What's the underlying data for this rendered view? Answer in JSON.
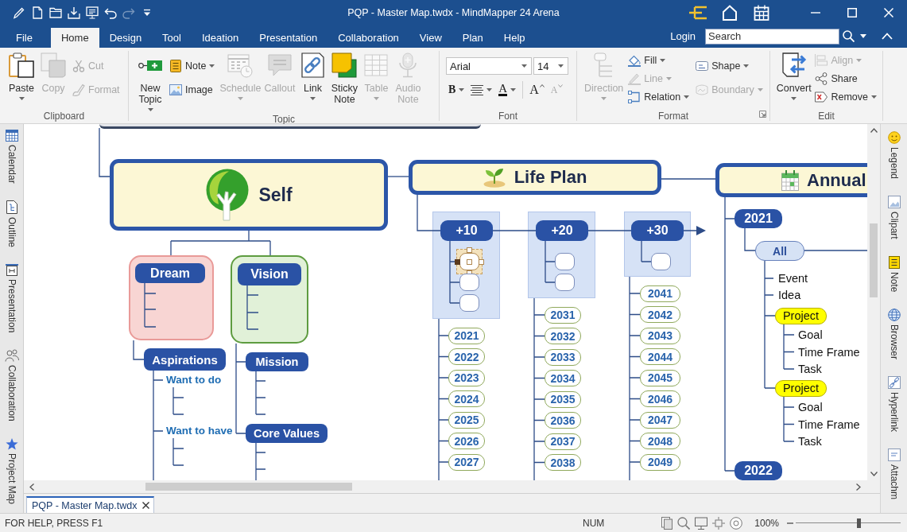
{
  "window": {
    "title": "PQP - Master Map.twdx - MindMapper 24 Arena"
  },
  "quick_access": [
    {
      "disabled": false
    },
    {
      "disabled": false
    },
    {
      "disabled": false
    },
    {
      "disabled": false
    },
    {
      "disabled": false
    },
    {
      "disabled": false
    },
    {
      "disabled": true
    },
    {
      "disabled": false
    }
  ],
  "menu": {
    "tabs": [
      {
        "label": "File",
        "selected": false
      },
      {
        "label": "Home",
        "selected": true
      },
      {
        "label": "Design",
        "selected": false
      },
      {
        "label": "Tool",
        "selected": false
      },
      {
        "label": "Ideation",
        "selected": false
      },
      {
        "label": "Presentation",
        "selected": false
      },
      {
        "label": "Collaboration",
        "selected": false
      },
      {
        "label": "View",
        "selected": false
      },
      {
        "label": "Plan",
        "selected": false
      },
      {
        "label": "Help",
        "selected": false
      }
    ],
    "login": "Login",
    "search": {
      "placeholder": "Search"
    }
  },
  "ribbon": {
    "groups": [
      {
        "label": "Clipboard",
        "launcher": false,
        "items": [
          {
            "kind": "large",
            "label": "Paste",
            "dropdown": true,
            "disabled": false
          },
          {
            "kind": "large",
            "label": "Copy",
            "dropdown": false,
            "disabled": true
          },
          {
            "kind": "stack",
            "items": [
              {
                "label": "Cut",
                "dropdown": false,
                "disabled": true
              },
              {
                "label": "Format",
                "dropdown": false,
                "disabled": true
              }
            ]
          }
        ]
      },
      {
        "label": "Topic",
        "launcher": false,
        "items": [
          {
            "kind": "large",
            "label": "New Topic",
            "dropdown": true,
            "disabled": false
          },
          {
            "kind": "stack",
            "items": [
              {
                "label": "Note",
                "dropdown": true,
                "disabled": false
              },
              {
                "label": "Image",
                "dropdown": false,
                "disabled": false
              }
            ]
          },
          {
            "kind": "large",
            "label": "Schedule",
            "dropdown": true,
            "disabled": true
          },
          {
            "kind": "large",
            "label": "Callout",
            "dropdown": false,
            "disabled": true
          },
          {
            "kind": "large",
            "label": "Link",
            "dropdown": true,
            "disabled": false
          },
          {
            "kind": "large",
            "label": "Sticky Note",
            "dropdown": false,
            "disabled": false
          },
          {
            "kind": "large",
            "label": "Table",
            "dropdown": true,
            "disabled": true
          },
          {
            "kind": "large",
            "label": "Audio Note",
            "dropdown": false,
            "disabled": true
          }
        ]
      },
      {
        "label": "Font",
        "launcher": false,
        "items": [
          {
            "kind": "font",
            "font": "Arial",
            "size": "14",
            "tools": [
              {
                "kind": "bold",
                "label": "B",
                "dropdown": true,
                "disabled": false
              },
              {
                "kind": "align",
                "dropdown": true,
                "disabled": false
              },
              {
                "kind": "color",
                "label": "A",
                "dropdown": true,
                "disabled": false
              },
              {
                "kind": "grow",
                "label": "A",
                "dropdown": false,
                "disabled": false
              },
              {
                "kind": "shrink",
                "label": "A",
                "dropdown": false,
                "disabled": true
              }
            ]
          }
        ]
      },
      {
        "label": "Format",
        "launcher": true,
        "items": [
          {
            "kind": "large",
            "label": "Direction",
            "dropdown": true,
            "disabled": true
          },
          {
            "kind": "stack",
            "items": [
              {
                "label": "Fill",
                "dropdown": true,
                "disabled": false
              },
              {
                "label": "Line",
                "dropdown": true,
                "disabled": true
              },
              {
                "label": "Relation",
                "dropdown": true,
                "disabled": false
              }
            ]
          },
          {
            "kind": "stack",
            "items": [
              {
                "label": "Shape",
                "dropdown": true,
                "disabled": false
              },
              {
                "label": "Boundary",
                "dropdown": true,
                "disabled": true
              }
            ]
          }
        ]
      },
      {
        "label": "Edit",
        "launcher": false,
        "items": [
          {
            "kind": "large",
            "label": "Convert",
            "dropdown": true,
            "disabled": false
          },
          {
            "kind": "stack",
            "items": [
              {
                "label": "Align",
                "dropdown": true,
                "disabled": true
              },
              {
                "label": "Share",
                "dropdown": false,
                "disabled": false
              },
              {
                "label": "Remove",
                "dropdown": true,
                "disabled": false
              }
            ]
          }
        ]
      }
    ]
  },
  "left_panel": {
    "tabs": [
      {
        "label": "Calendar",
        "selected": false
      },
      {
        "label": "Outline",
        "selected": false
      },
      {
        "label": "Presentation",
        "selected": false
      },
      {
        "label": "Collaboration",
        "selected": false
      },
      {
        "label": "Project Map",
        "selected": false
      }
    ]
  },
  "map": {
    "topics": [
      {
        "title": "Self",
        "subtopics": [
          {
            "title": "Dream",
            "color": "#f8d5d3",
            "subtopics": [
              {
                "title": "Aspirations",
                "subtopics": [
                  {
                    "title": "Want to do"
                  },
                  {
                    "title": "Want to have"
                  }
                ]
              }
            ]
          },
          {
            "title": "Vision",
            "color": "#e1f1d8",
            "subtopics": [
              {
                "title": "Mission"
              },
              {
                "title": "Core Values"
              }
            ]
          }
        ]
      },
      {
        "title": "Life Plan",
        "subtopics": [
          {
            "title": "+10",
            "subtopics": [
              {
                "selected": true
              },
              {
                "selected": false
              },
              {
                "selected": false
              }
            ],
            "years": [
              "2021",
              "2022",
              "2023",
              "2024",
              "2025",
              "2026",
              "2027"
            ]
          },
          {
            "title": "+20",
            "subtopics": [
              {
                "selected": false
              },
              {
                "selected": false
              }
            ],
            "years": [
              "2031",
              "2032",
              "2033",
              "2034",
              "2035",
              "2036",
              "2037",
              "2038"
            ]
          },
          {
            "title": "+30",
            "subtopics": [
              {
                "selected": false
              }
            ],
            "years": [
              "2041",
              "2042",
              "2043",
              "2044",
              "2045",
              "2046",
              "2047",
              "2048",
              "2049"
            ]
          }
        ]
      },
      {
        "title": "Annual",
        "subtopics": [
          {
            "title": "2021",
            "subtopics": [
              {
                "title": "All",
                "subtopics": [
                  {
                    "kind": "plain",
                    "title": "Event"
                  },
                  {
                    "kind": "plain",
                    "title": "Idea"
                  },
                  {
                    "kind": "pill",
                    "title": "Project",
                    "color": "#ffff00",
                    "subtopics": [
                      {
                        "title": "Goal"
                      },
                      {
                        "title": "Time Frame"
                      },
                      {
                        "title": "Task"
                      }
                    ]
                  },
                  {
                    "kind": "pill",
                    "title": "Project",
                    "color": "#ffff00",
                    "subtopics": [
                      {
                        "title": "Goal"
                      },
                      {
                        "title": "Time Frame"
                      },
                      {
                        "title": "Task"
                      }
                    ]
                  }
                ]
              }
            ]
          },
          {
            "title": "2022"
          }
        ]
      }
    ]
  },
  "right_panel": {
    "tabs": [
      {
        "label": "Legend",
        "selected": false
      },
      {
        "label": "Clipart",
        "selected": false
      },
      {
        "label": "Note",
        "selected": false
      },
      {
        "label": "Browser",
        "selected": false
      },
      {
        "label": "Hyperlink",
        "selected": false
      },
      {
        "label": "Attachm",
        "selected": false
      }
    ]
  },
  "document_tabs": [
    {
      "label": "PQP - Master Map.twdx",
      "selected": true
    }
  ],
  "status_bar": {
    "help": "FOR HELP, PRESS F1",
    "num": "NUM",
    "zoom": {
      "reading": "100%",
      "level": 0.6
    }
  }
}
